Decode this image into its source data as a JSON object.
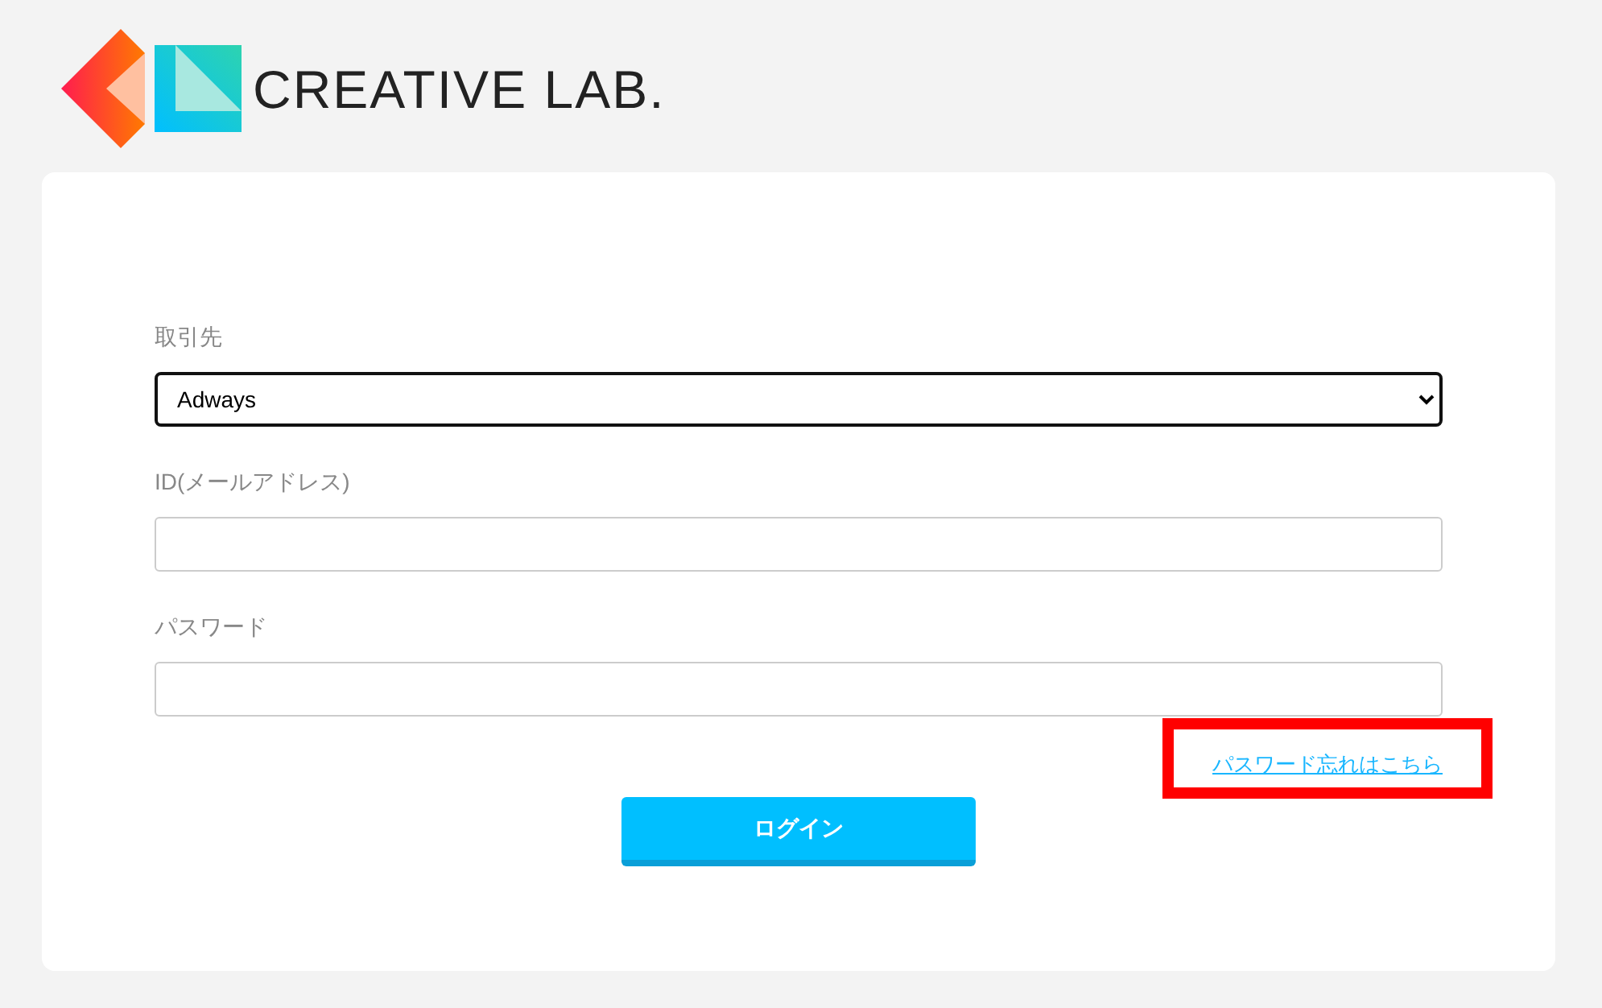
{
  "logo": {
    "text": "CREATIVE LAB."
  },
  "form": {
    "fields": [
      {
        "kind": "select",
        "label": "取引先",
        "value": "Adways",
        "focused": true
      },
      {
        "kind": "text",
        "label": "ID(メールアドレス)",
        "focused": false
      },
      {
        "kind": "password",
        "label": "パスワード",
        "focused": false
      }
    ],
    "forgot_link": {
      "text": "パスワード忘れはこちら",
      "highlighted": true
    },
    "submit": {
      "label": "ログイン"
    }
  }
}
